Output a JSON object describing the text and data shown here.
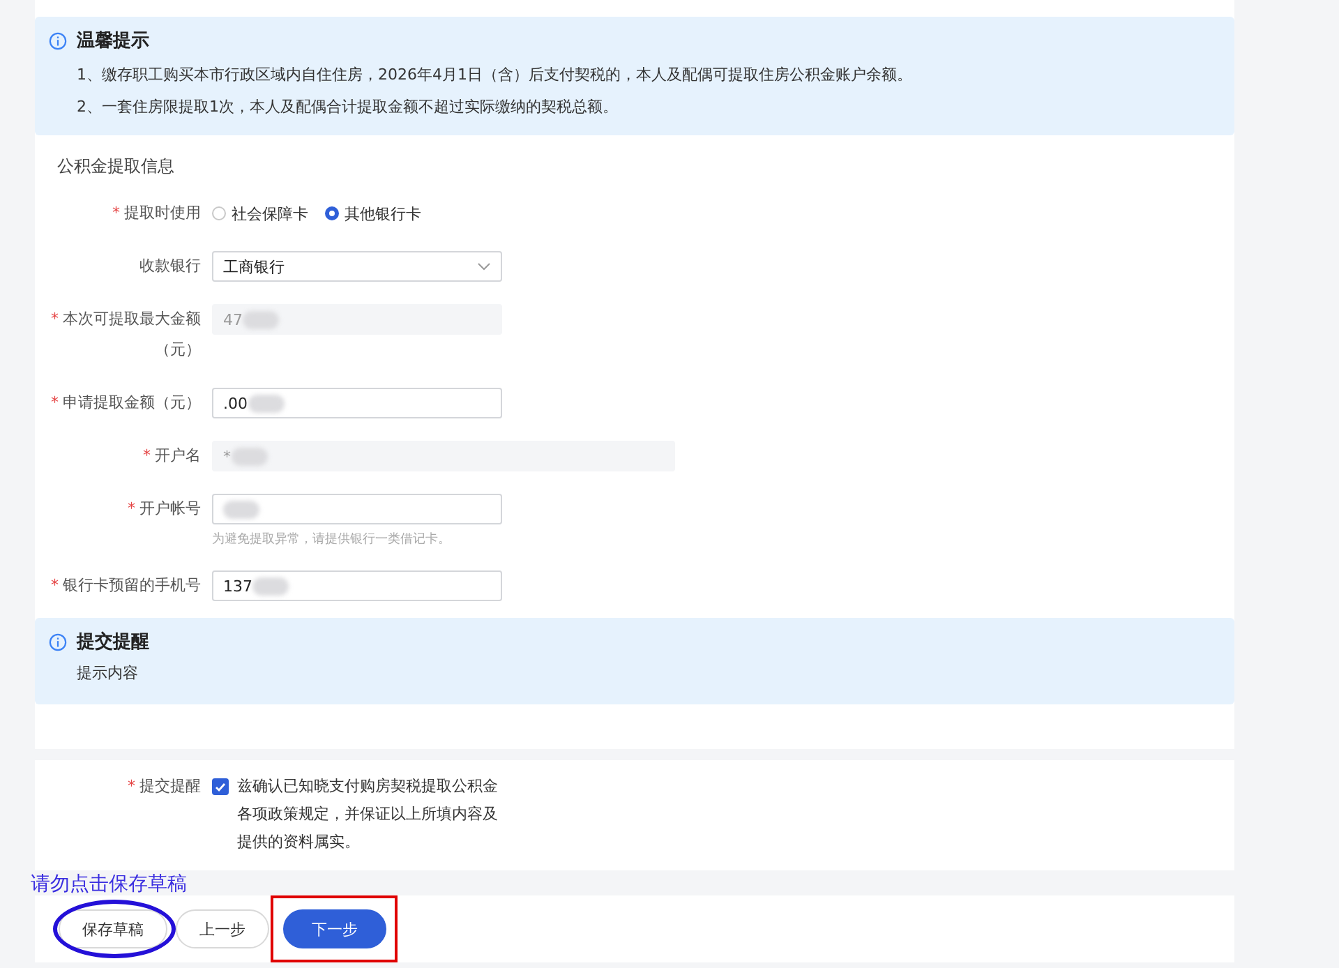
{
  "notice": {
    "title": "温馨提示",
    "lines": [
      "1、缴存职工购买本市行政区域内自住住房，2026年4月1日（含）后支付契税的，本人及配偶可提取住房公积金账户余额。",
      "2、一套住房限提取1次，本人及配偶合计提取金额不超过实际缴纳的契税总额。"
    ]
  },
  "section_title": "公积金提取信息",
  "fields": [
    {
      "kind": "radio",
      "label": "提取时使用",
      "required_mark": "*",
      "options": [
        {
          "label": "社会保障卡",
          "selected": false
        },
        {
          "label": "其他银行卡",
          "selected": true
        }
      ]
    },
    {
      "kind": "select",
      "label": "收款银行",
      "value": "工商银行"
    },
    {
      "kind": "input",
      "label": "本次可提取最大金额（元）",
      "required_mark": "*",
      "value": "47",
      "disabled": true,
      "wide": false,
      "redacted": true
    },
    {
      "kind": "input",
      "label": "申请提取金额（元）",
      "required_mark": "*",
      "value": ".00",
      "disabled": false,
      "wide": false,
      "redacted": true
    },
    {
      "kind": "input",
      "label": "开户名",
      "required_mark": "*",
      "value": "*",
      "disabled": true,
      "wide": true,
      "redacted": true
    },
    {
      "kind": "input",
      "label": "开户帐号",
      "required_mark": "*",
      "disabled": false,
      "wide": false,
      "redacted": true,
      "hint": "为避免提取异常，请提供银行一类借记卡。"
    },
    {
      "kind": "input",
      "label": "银行卡预留的手机号",
      "required_mark": "*",
      "value": "137",
      "disabled": false,
      "wide": false,
      "redacted": true
    }
  ],
  "reminder": {
    "title": "提交提醒",
    "text": "提示内容"
  },
  "agreement": {
    "label": "提交提醒",
    "required_mark": "*",
    "checked": true,
    "text": "兹确认已知晓支付购房契税提取公积金各项政策规定，并保证以上所填内容及提供的资料属实。"
  },
  "annotation_note": "请勿点击保存草稿",
  "buttons": [
    {
      "label": "保存草稿",
      "kind": "secondary",
      "circled": true,
      "boxed": false
    },
    {
      "label": "上一步",
      "kind": "secondary",
      "circled": false,
      "boxed": false
    },
    {
      "label": "下一步",
      "kind": "primary",
      "circled": false,
      "boxed": true
    }
  ]
}
